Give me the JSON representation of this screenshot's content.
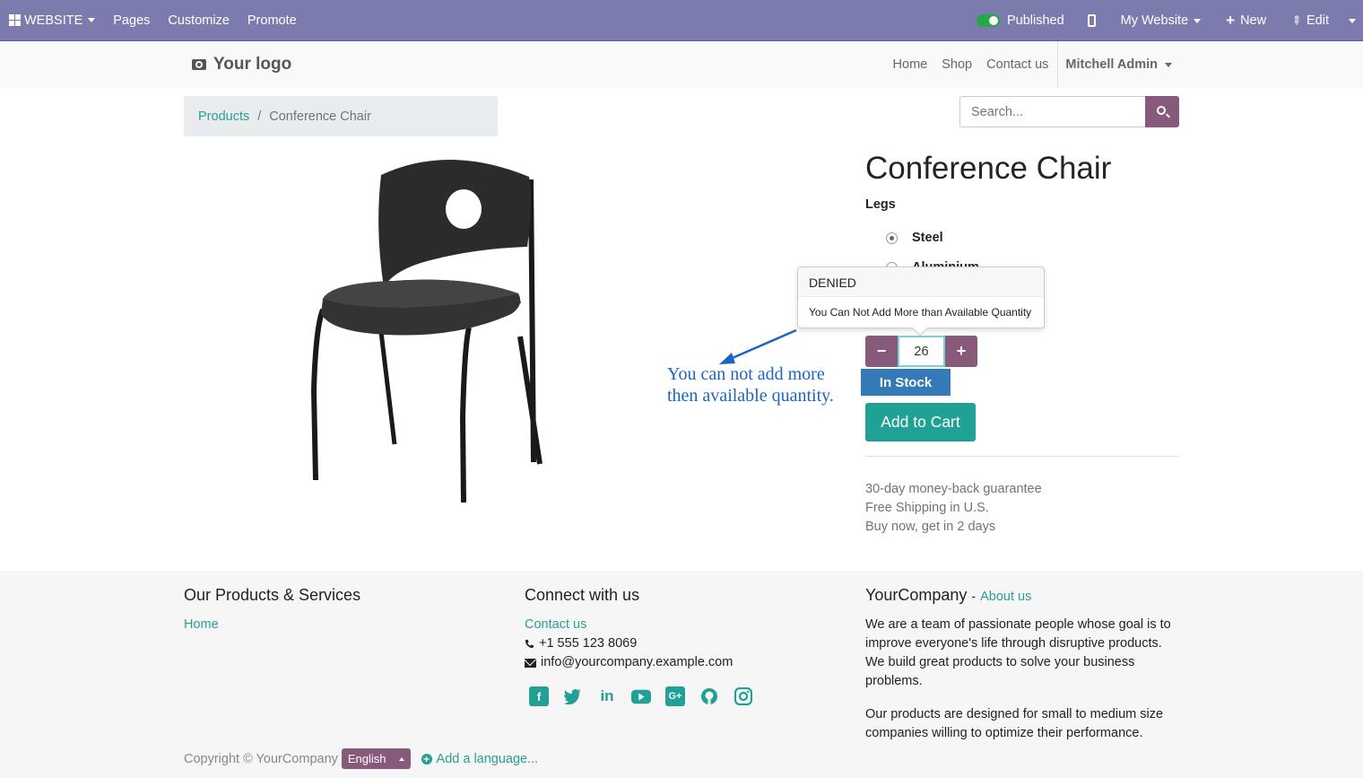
{
  "admin_bar": {
    "app_menu": "WEBSITE",
    "pages": "Pages",
    "customize": "Customize",
    "promote": "Promote",
    "published": "Published",
    "website_select": "My Website",
    "new": "New",
    "edit": "Edit"
  },
  "header": {
    "logo": "Your logo",
    "nav": [
      "Home",
      "Shop",
      "Contact us"
    ],
    "user": "Mitchell Admin"
  },
  "breadcrumb": {
    "parent": "Products",
    "separator": "/",
    "current": "Conference Chair"
  },
  "search": {
    "placeholder": "Search..."
  },
  "product": {
    "title": "Conference Chair",
    "attribute_label": "Legs",
    "options": [
      "Steel",
      "Aluminium"
    ],
    "selected_option": "Steel",
    "quantity": "26",
    "stock_status": "In Stock",
    "add_to_cart": "Add to Cart",
    "benefits": [
      "30-day money-back guarantee",
      "Free Shipping in U.S.",
      "Buy now, get in 2 days"
    ]
  },
  "popover": {
    "title": "DENIED",
    "message": "You Can Not Add More than Available Quantity"
  },
  "annotation": {
    "line1": "You can not add more",
    "line2": "then available quantity.",
    "color": "#1b64c3"
  },
  "footer": {
    "col1": {
      "heading": "Our Products & Services",
      "link": "Home"
    },
    "col2": {
      "heading": "Connect with us",
      "link": "Contact us",
      "phone": "+1 555 123 8069",
      "email": "info@yourcompany.example.com"
    },
    "col3": {
      "heading": "YourCompany",
      "heading_sep": "-",
      "about": "About us",
      "p1": "We are a team of passionate people whose goal is to improve everyone's life through disruptive products. We build great products to solve your business problems.",
      "p2": "Our products are designed for small to medium size companies willing to optimize their performance."
    },
    "social_icons": [
      "facebook-icon",
      "twitter-icon",
      "linkedin-icon",
      "youtube-icon",
      "google-plus-icon",
      "github-icon",
      "instagram-icon"
    ],
    "copyright": "Copyright © YourCompany",
    "language": "English",
    "add_language": "Add a language..."
  },
  "colors": {
    "admin_bar": "#7c7bad",
    "primary": "#875a7b",
    "accent": "#21a095",
    "stock_badge": "#337ab7"
  }
}
